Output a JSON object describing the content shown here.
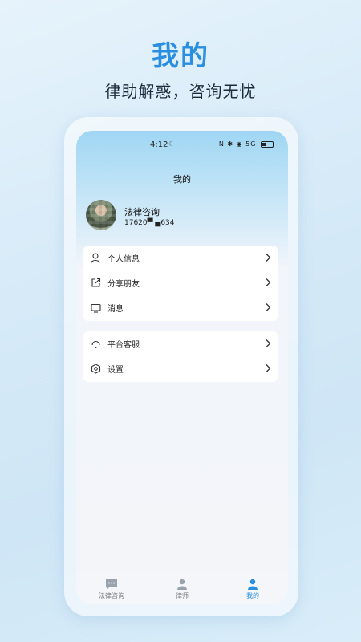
{
  "poster": {
    "title": "我的",
    "subtitle": "律助解惑，咨询无忧"
  },
  "status_bar": {
    "time": "4:12",
    "indicators": "N ✱ ◉ 5G",
    "icons": [
      "nfc-icon",
      "bluetooth-icon",
      "wifi-icon",
      "signal-icon",
      "battery-icon"
    ]
  },
  "page": {
    "title": "我的"
  },
  "user": {
    "name": "法律咨询",
    "phone": "17620▀ ▄634"
  },
  "menu_group_1": [
    {
      "label": "个人信息",
      "icon": "person-icon"
    },
    {
      "label": "分享朋友",
      "icon": "share-icon"
    },
    {
      "label": "消息",
      "icon": "message-icon"
    }
  ],
  "menu_group_2": [
    {
      "label": "平台客服",
      "icon": "headset-icon"
    },
    {
      "label": "设置",
      "icon": "settings-icon"
    }
  ],
  "tabbar": [
    {
      "label": "法律咨询",
      "icon": "chat-icon",
      "active": false
    },
    {
      "label": "律师",
      "icon": "lawyer-icon",
      "active": false
    },
    {
      "label": "我的",
      "icon": "profile-icon",
      "active": true
    }
  ],
  "colors": {
    "accent": "#2a8fe0",
    "header_gradient_top": "#9fd6f3",
    "background": "#f3f5f9"
  }
}
